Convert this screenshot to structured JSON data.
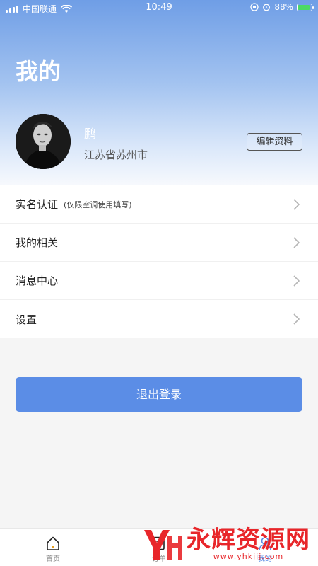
{
  "status_bar": {
    "carrier": "中国联通",
    "time": "10:49",
    "battery_percent": "88%",
    "battery_level": 0.88
  },
  "page": {
    "title": "我的"
  },
  "profile": {
    "name": "鹏",
    "location": "江苏省苏州市",
    "edit_label": "编辑资料"
  },
  "menu": {
    "items": [
      {
        "label": "实名认证",
        "note": "(仅限空调使用填写)",
        "icon": "chevron-right-icon"
      },
      {
        "label": "我的相关",
        "note": "",
        "icon": "chevron-right-icon"
      },
      {
        "label": "消息中心",
        "note": "",
        "icon": "chevron-right-icon"
      },
      {
        "label": "设置",
        "note": "",
        "icon": "chevron-right-icon"
      }
    ]
  },
  "logout": {
    "label": "退出登录"
  },
  "tabbar": {
    "tabs": [
      {
        "label": "首页",
        "icon": "home-icon"
      },
      {
        "label": "订单",
        "icon": "order-icon"
      },
      {
        "label": "我的",
        "icon": "user-icon",
        "active": true
      }
    ]
  },
  "watermark": {
    "brand": "永辉资源网",
    "url": "www.yhkjjj.com"
  },
  "colors": {
    "accent": "#5b8de6",
    "header_top": "#6f9ee6",
    "watermark": "#e8262a"
  }
}
